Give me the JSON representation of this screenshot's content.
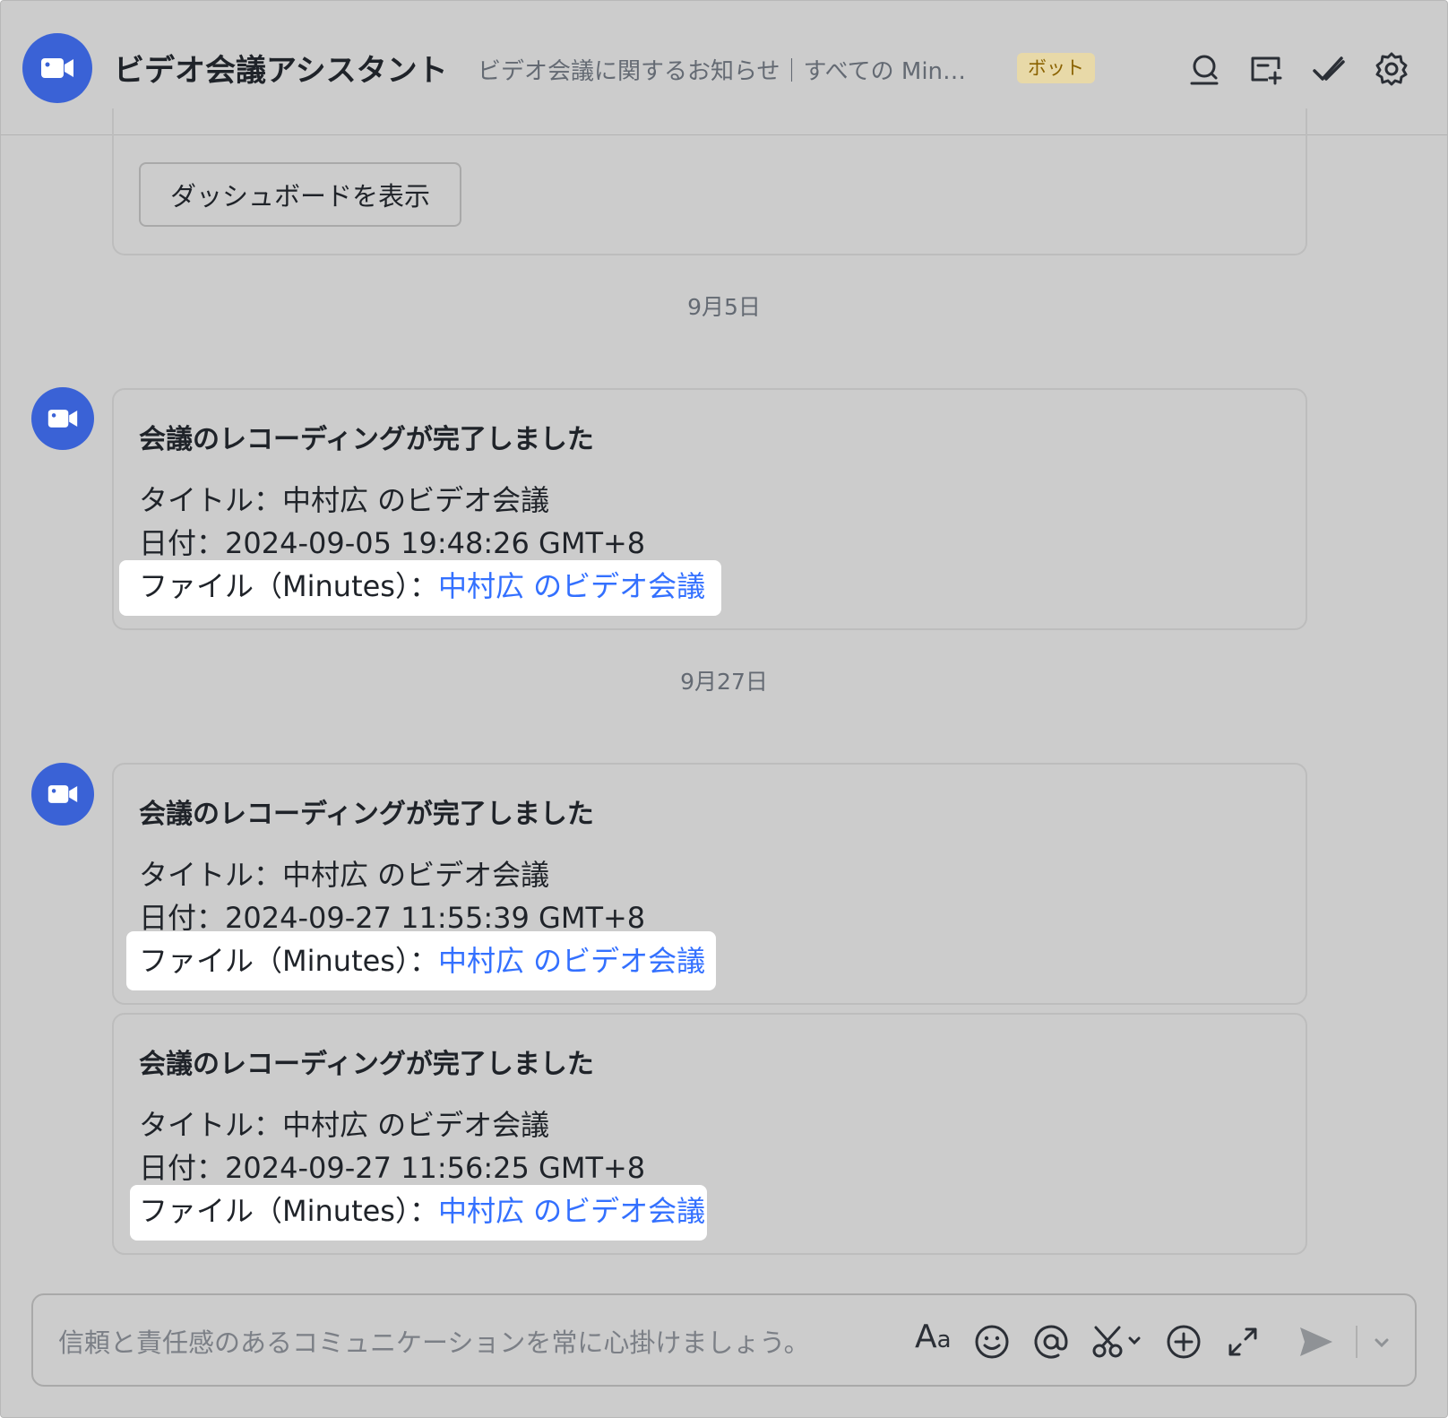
{
  "header": {
    "title": "ビデオ会議アシスタント",
    "description": "ビデオ会議に関するお知らせ｜すべての Min…",
    "badge": "ボット"
  },
  "top_card": {
    "button_label": "ダッシュボードを表示"
  },
  "date_separators": [
    "9月5日",
    "9月27日"
  ],
  "messages": [
    {
      "heading": "会議のレコーディングが完了しました",
      "title_line": "タイトル：中村広 のビデオ会議",
      "date_line": "日付：2024-09-05 19:48:26 GMT+8",
      "file_label": "ファイル（Minutes）：",
      "file_link": "中村広 のビデオ会議"
    },
    {
      "heading": "会議のレコーディングが完了しました",
      "title_line": "タイトル：中村広 のビデオ会議",
      "date_line": "日付：2024-09-27 11:55:39 GMT+8",
      "file_label": "ファイル（Minutes）：",
      "file_link": "中村広 のビデオ会議"
    },
    {
      "heading": "会議のレコーディングが完了しました",
      "title_line": "タイトル：中村広 のビデオ会議",
      "date_line": "日付：2024-09-27 11:56:25 GMT+8",
      "file_label": "ファイル（Minutes）：",
      "file_link": "中村広 のビデオ会議"
    }
  ],
  "composer": {
    "placeholder": "信頼と責任感のあるコミュニケーションを常に心掛けましょう。",
    "format_label": "A",
    "format_label_small": "a"
  },
  "colors": {
    "accent": "#3a62d6",
    "link": "#3370ff",
    "background": "#cccccc",
    "badge_bg": "#e8d9a8"
  },
  "icons": [
    "video-camera-icon",
    "search-icon",
    "add-tab-icon",
    "mark-done-icon",
    "settings-icon",
    "emoji-icon",
    "mention-icon",
    "screenshot-icon",
    "add-icon",
    "expand-icon",
    "send-icon",
    "chevron-down-icon"
  ]
}
